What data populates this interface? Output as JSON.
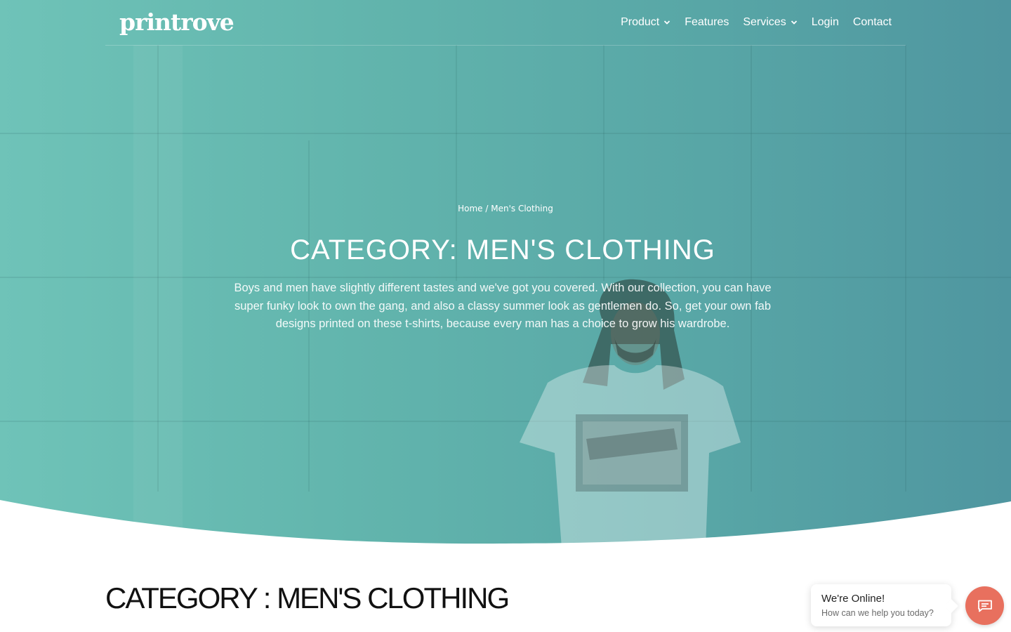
{
  "brand": {
    "logo_text": "printrove",
    "accent_color": "#e8705e",
    "hero_tint": "#62b5ad"
  },
  "nav": {
    "items": [
      {
        "label": "Product",
        "has_dropdown": true
      },
      {
        "label": "Features",
        "has_dropdown": false
      },
      {
        "label": "Services",
        "has_dropdown": true
      },
      {
        "label": "Login",
        "has_dropdown": false
      },
      {
        "label": "Contact",
        "has_dropdown": false
      }
    ]
  },
  "hero": {
    "breadcrumb": {
      "home": "Home",
      "separator": " / ",
      "current": "Men's Clothing"
    },
    "title": "CATEGORY: MEN'S CLOTHING",
    "description": "Boys and men have slightly different tastes and we've got you covered. With our collection, you can have super funky look to own the gang, and also a classy summer look as gentlemen do. So, get your own fab designs printed on these t-shirts, because every man has a choice to grow his wardrobe."
  },
  "main": {
    "heading": "CATEGORY : MEN'S CLOTHING"
  },
  "chat": {
    "title": "We're Online!",
    "subtitle": "How can we help you today?",
    "button_icon": "chat-icon"
  }
}
